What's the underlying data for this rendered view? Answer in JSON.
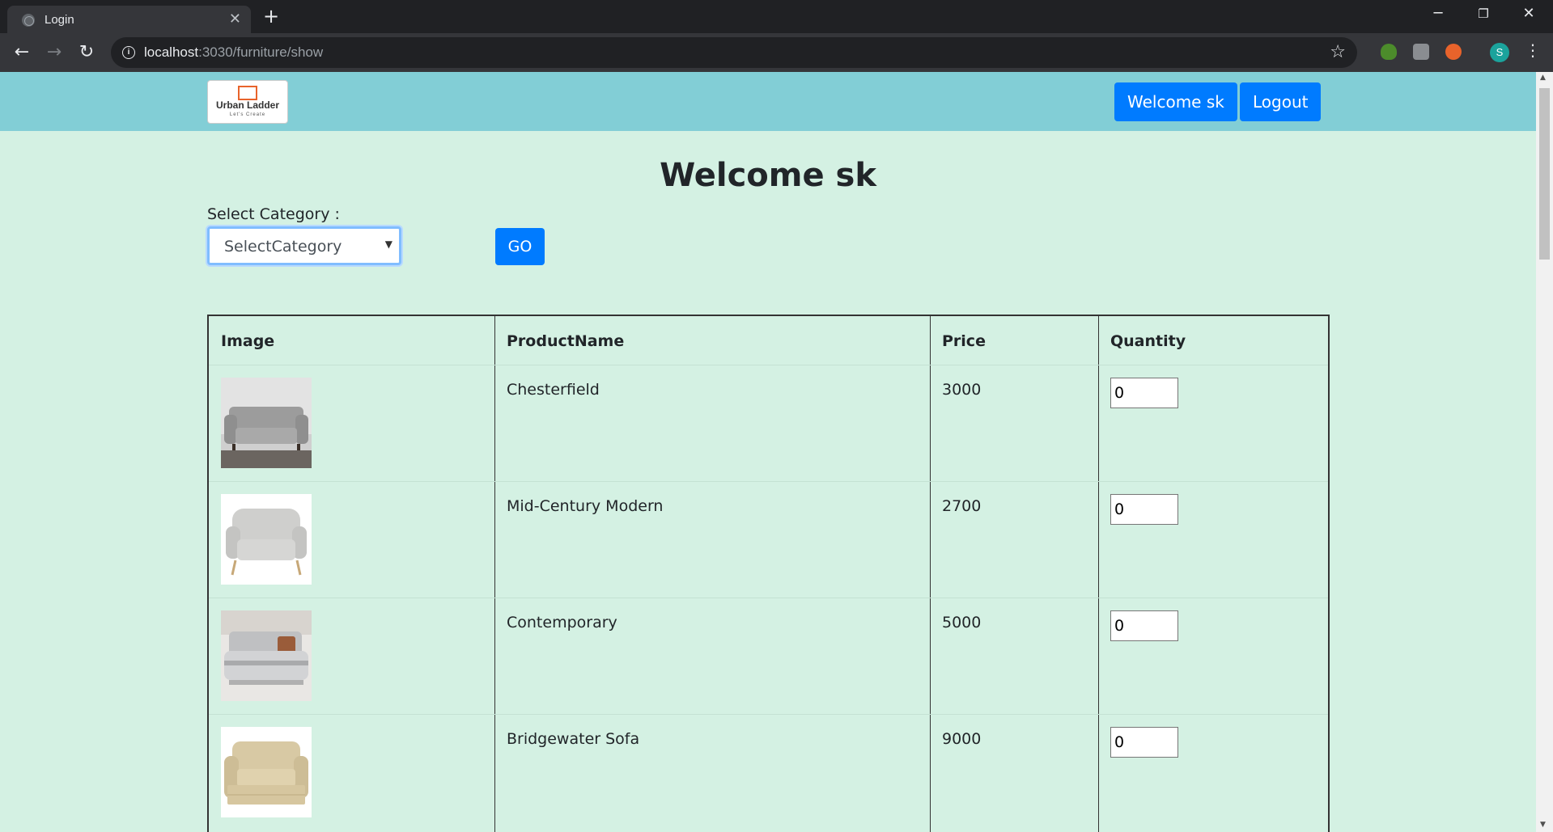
{
  "browser": {
    "tab_title": "Login",
    "url_host": "localhost",
    "url_rest": ":3030/furniture/show",
    "profile_initial": "S"
  },
  "navbar": {
    "logo_title": "Urban Ladder",
    "logo_tagline": "Let's Create",
    "welcome_button": "Welcome sk",
    "logout_button": "Logout"
  },
  "main": {
    "heading": "Welcome sk",
    "category_label": "Select Category :",
    "category_selected": "SelectCategory",
    "go_button": "GO"
  },
  "table": {
    "headers": [
      "Image",
      "ProductName",
      "Price",
      "Quantity"
    ],
    "rows": [
      {
        "name": "Chesterfield",
        "price": "3000",
        "quantity": "0"
      },
      {
        "name": "Mid-Century Modern",
        "price": "2700",
        "quantity": "0"
      },
      {
        "name": "Contemporary",
        "price": "5000",
        "quantity": "0"
      },
      {
        "name": "Bridgewater Sofa",
        "price": "9000",
        "quantity": "0"
      }
    ]
  },
  "colors": {
    "page_background": "#d4f1e3",
    "navbar": "#82ced6",
    "primary_button": "#007bff"
  }
}
